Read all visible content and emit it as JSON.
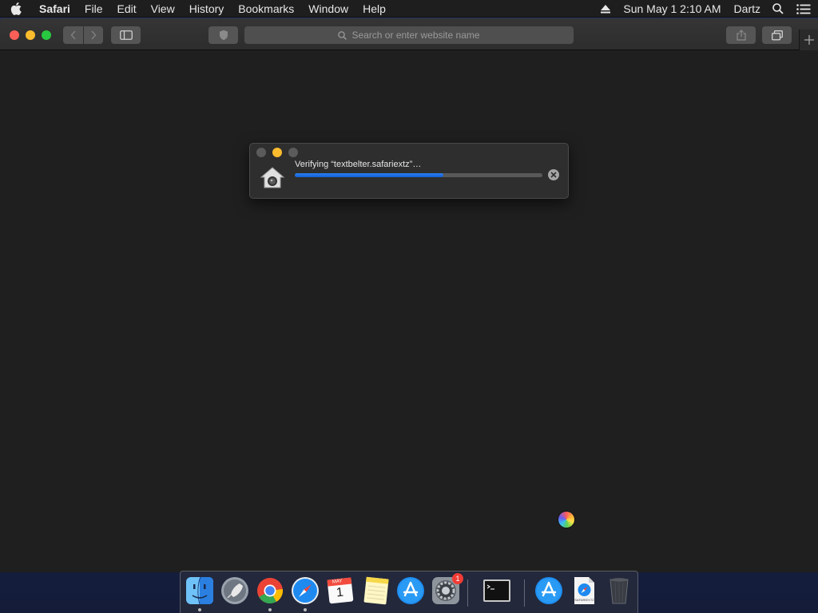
{
  "menubar": {
    "app_name": "Safari",
    "menus": [
      "File",
      "Edit",
      "View",
      "History",
      "Bookmarks",
      "Window",
      "Help"
    ],
    "clock": "Sun May 1  2:10 AM",
    "user": "Dartz"
  },
  "toolbar": {
    "address_placeholder": "Search or enter website name"
  },
  "dialog": {
    "title": "Verifying “textbelter.safariextz”…",
    "progress": 0.6
  },
  "dock": {
    "apps": [
      "Finder",
      "Launchpad",
      "Google Chrome",
      "Safari",
      "Calendar",
      "Notes",
      "App Store",
      "System Preferences",
      "Terminal",
      "Applications",
      "safariextz document",
      "Trash"
    ],
    "calendar_month": "MAY",
    "calendar_day": "1",
    "system_prefs_badge": "1",
    "doc_label": "SAFARIEXTZ"
  },
  "colors": {
    "accent": "#1460d6",
    "close": "#fc5f57",
    "minimize": "#fdbc2e",
    "zoom": "#28c840"
  }
}
